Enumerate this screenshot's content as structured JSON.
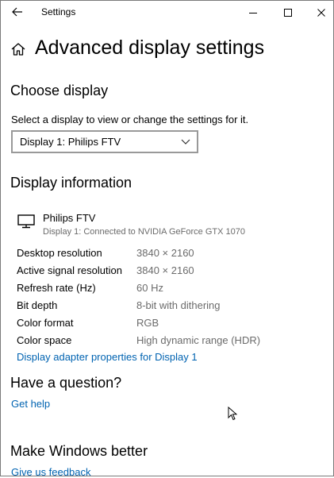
{
  "window": {
    "title": "Settings"
  },
  "page": {
    "title": "Advanced display settings"
  },
  "choose_display": {
    "heading": "Choose display",
    "description": "Select a display to view or change the settings for it.",
    "selected": "Display 1: Philips FTV"
  },
  "display_info": {
    "heading": "Display information",
    "monitor_name": "Philips FTV",
    "monitor_sub": "Display 1: Connected to NVIDIA GeForce GTX 1070",
    "rows": [
      {
        "label": "Desktop resolution",
        "value": "3840 × 2160"
      },
      {
        "label": "Active signal resolution",
        "value": "3840 × 2160"
      },
      {
        "label": "Refresh rate (Hz)",
        "value": "60 Hz"
      },
      {
        "label": "Bit depth",
        "value": "8-bit with dithering"
      },
      {
        "label": "Color format",
        "value": "RGB"
      },
      {
        "label": "Color space",
        "value": "High dynamic range (HDR)"
      }
    ],
    "adapter_link": "Display adapter properties for Display 1"
  },
  "question": {
    "heading": "Have a question?",
    "link": "Get help"
  },
  "better": {
    "heading": "Make Windows better",
    "link": "Give us feedback"
  },
  "colors": {
    "accent_link": "#0063b1",
    "secondary_text": "#6b6b6b"
  }
}
